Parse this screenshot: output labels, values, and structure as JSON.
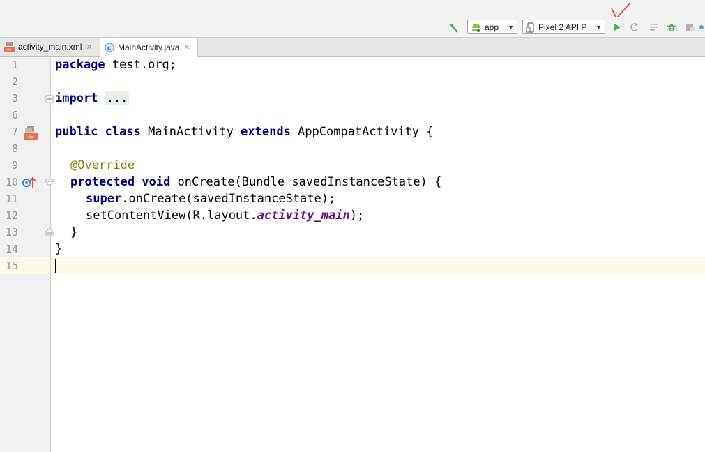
{
  "toolbar": {
    "run_config": "app",
    "device": "Pixel 2 API P"
  },
  "tabs": [
    {
      "label": "activity_main.xml",
      "active": false
    },
    {
      "label": "MainActivity.java",
      "active": true
    }
  ],
  "editor": {
    "current_line": 15,
    "lines": [
      {
        "num": "1"
      },
      {
        "num": "2"
      },
      {
        "num": "3"
      },
      {
        "num": "6"
      },
      {
        "num": "7"
      },
      {
        "num": "8"
      },
      {
        "num": "9"
      },
      {
        "num": "10"
      },
      {
        "num": "11"
      },
      {
        "num": "12"
      },
      {
        "num": "13"
      },
      {
        "num": "14"
      },
      {
        "num": "15"
      }
    ],
    "tokens": {
      "l1_kw": "package",
      "l1_rest": " test.org;",
      "l3_kw": "import",
      "l3_fold": "...",
      "l7_kw1": "public",
      "l7_kw2": "class",
      "l7_name": " MainActivity ",
      "l7_kw3": "extends",
      "l7_rest": " AppCompatActivity {",
      "l9_ann": "@Override",
      "l10_kw1": "protected",
      "l10_kw2": "void",
      "l10_rest": " onCreate(Bundle savedInstanceState) {",
      "l11_kw": "super",
      "l11_rest": ".onCreate(savedInstanceState);",
      "l12_a": "setContentView(R.layout.",
      "l12_field": "activity_main",
      "l12_b": ");",
      "l13": "}",
      "l14": "}"
    }
  },
  "colors": {
    "keyword": "#000080",
    "annotation": "#808000",
    "field": "#660e7a",
    "run_green": "#4caf50",
    "annotation_check": "#e53935"
  }
}
